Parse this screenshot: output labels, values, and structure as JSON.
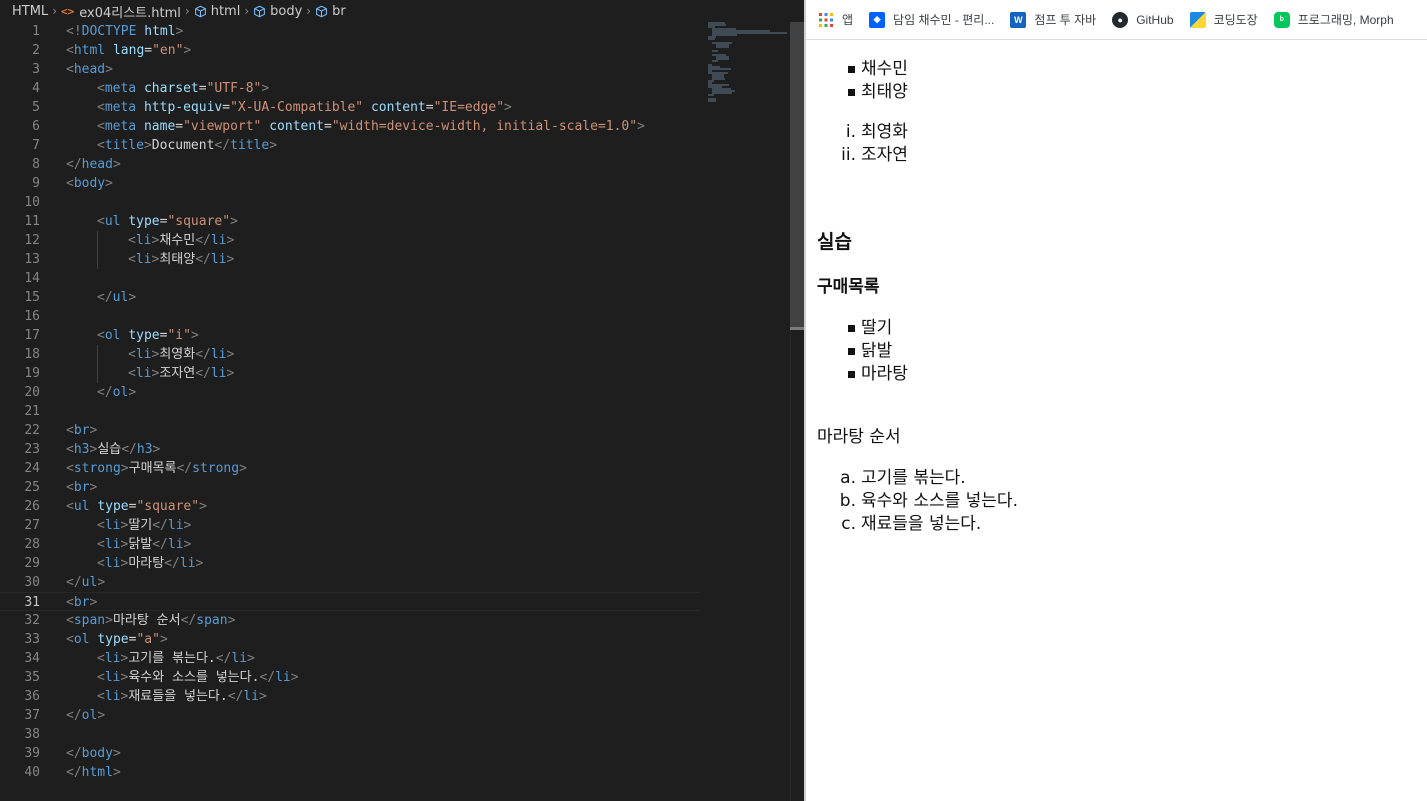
{
  "editor": {
    "breadcrumb": {
      "language": "HTML",
      "file": "ex04리스트.html",
      "path": [
        "html",
        "body",
        "br"
      ]
    },
    "active_line": 31,
    "lines": [
      {
        "n": "1",
        "indent": 0,
        "parts": [
          [
            "tg",
            "<!"
          ],
          [
            "tn",
            "DOCTYPE"
          ],
          [
            "tx",
            " "
          ],
          [
            "an",
            "html"
          ],
          [
            "tg",
            ">"
          ]
        ]
      },
      {
        "n": "2",
        "indent": 0,
        "parts": [
          [
            "tg",
            "<"
          ],
          [
            "tn",
            "html"
          ],
          [
            "tx",
            " "
          ],
          [
            "an",
            "lang"
          ],
          [
            "tx",
            "="
          ],
          [
            "av",
            "\"en\""
          ],
          [
            "tg",
            ">"
          ]
        ]
      },
      {
        "n": "3",
        "indent": 0,
        "parts": [
          [
            "tg",
            "<"
          ],
          [
            "tn",
            "head"
          ],
          [
            "tg",
            ">"
          ]
        ]
      },
      {
        "n": "4",
        "indent": 1,
        "parts": [
          [
            "tg",
            "<"
          ],
          [
            "tn",
            "meta"
          ],
          [
            "tx",
            " "
          ],
          [
            "an",
            "charset"
          ],
          [
            "tx",
            "="
          ],
          [
            "av",
            "\"UTF-8\""
          ],
          [
            "tg",
            ">"
          ]
        ]
      },
      {
        "n": "5",
        "indent": 1,
        "parts": [
          [
            "tg",
            "<"
          ],
          [
            "tn",
            "meta"
          ],
          [
            "tx",
            " "
          ],
          [
            "an",
            "http-equiv"
          ],
          [
            "tx",
            "="
          ],
          [
            "av",
            "\"X-UA-Compatible\""
          ],
          [
            "tx",
            " "
          ],
          [
            "an",
            "content"
          ],
          [
            "tx",
            "="
          ],
          [
            "av",
            "\"IE=edge\""
          ],
          [
            "tg",
            ">"
          ]
        ]
      },
      {
        "n": "6",
        "indent": 1,
        "parts": [
          [
            "tg",
            "<"
          ],
          [
            "tn",
            "meta"
          ],
          [
            "tx",
            " "
          ],
          [
            "an",
            "name"
          ],
          [
            "tx",
            "="
          ],
          [
            "av",
            "\"viewport\""
          ],
          [
            "tx",
            " "
          ],
          [
            "an",
            "content"
          ],
          [
            "tx",
            "="
          ],
          [
            "av",
            "\"width=device-width, initial-scale=1.0\""
          ],
          [
            "tg",
            ">"
          ]
        ]
      },
      {
        "n": "7",
        "indent": 1,
        "parts": [
          [
            "tg",
            "<"
          ],
          [
            "tn",
            "title"
          ],
          [
            "tg",
            ">"
          ],
          [
            "tx",
            "Document"
          ],
          [
            "tg",
            "</"
          ],
          [
            "tn",
            "title"
          ],
          [
            "tg",
            ">"
          ]
        ]
      },
      {
        "n": "8",
        "indent": 0,
        "parts": [
          [
            "tg",
            "</"
          ],
          [
            "tn",
            "head"
          ],
          [
            "tg",
            ">"
          ]
        ]
      },
      {
        "n": "9",
        "indent": 0,
        "parts": [
          [
            "tg",
            "<"
          ],
          [
            "tn",
            "body"
          ],
          [
            "tg",
            ">"
          ]
        ]
      },
      {
        "n": "10",
        "indent": 0,
        "parts": []
      },
      {
        "n": "11",
        "indent": 1,
        "parts": [
          [
            "tg",
            "<"
          ],
          [
            "tn",
            "ul"
          ],
          [
            "tx",
            " "
          ],
          [
            "an",
            "type"
          ],
          [
            "tx",
            "="
          ],
          [
            "av",
            "\"square\""
          ],
          [
            "tg",
            ">"
          ]
        ]
      },
      {
        "n": "12",
        "indent": 2,
        "parts": [
          [
            "tg",
            "<"
          ],
          [
            "tn",
            "li"
          ],
          [
            "tg",
            ">"
          ],
          [
            "tx",
            "채수민"
          ],
          [
            "tg",
            "</"
          ],
          [
            "tn",
            "li"
          ],
          [
            "tg",
            ">"
          ]
        ]
      },
      {
        "n": "13",
        "indent": 2,
        "parts": [
          [
            "tg",
            "<"
          ],
          [
            "tn",
            "li"
          ],
          [
            "tg",
            ">"
          ],
          [
            "tx",
            "최태양"
          ],
          [
            "tg",
            "</"
          ],
          [
            "tn",
            "li"
          ],
          [
            "tg",
            ">"
          ]
        ]
      },
      {
        "n": "14",
        "indent": 0,
        "parts": []
      },
      {
        "n": "15",
        "indent": 1,
        "parts": [
          [
            "tg",
            "</"
          ],
          [
            "tn",
            "ul"
          ],
          [
            "tg",
            ">"
          ]
        ]
      },
      {
        "n": "16",
        "indent": 0,
        "parts": []
      },
      {
        "n": "17",
        "indent": 1,
        "parts": [
          [
            "tg",
            "<"
          ],
          [
            "tn",
            "ol"
          ],
          [
            "tx",
            " "
          ],
          [
            "an",
            "type"
          ],
          [
            "tx",
            "="
          ],
          [
            "av",
            "\"i\""
          ],
          [
            "tg",
            ">"
          ]
        ]
      },
      {
        "n": "18",
        "indent": 2,
        "parts": [
          [
            "tg",
            "<"
          ],
          [
            "tn",
            "li"
          ],
          [
            "tg",
            ">"
          ],
          [
            "tx",
            "최영화"
          ],
          [
            "tg",
            "</"
          ],
          [
            "tn",
            "li"
          ],
          [
            "tg",
            ">"
          ]
        ]
      },
      {
        "n": "19",
        "indent": 2,
        "parts": [
          [
            "tg",
            "<"
          ],
          [
            "tn",
            "li"
          ],
          [
            "tg",
            ">"
          ],
          [
            "tx",
            "조자연"
          ],
          [
            "tg",
            "</"
          ],
          [
            "tn",
            "li"
          ],
          [
            "tg",
            ">"
          ]
        ]
      },
      {
        "n": "20",
        "indent": 1,
        "parts": [
          [
            "tg",
            "</"
          ],
          [
            "tn",
            "ol"
          ],
          [
            "tg",
            ">"
          ]
        ]
      },
      {
        "n": "21",
        "indent": 0,
        "parts": []
      },
      {
        "n": "22",
        "indent": 0,
        "parts": [
          [
            "tg",
            "<"
          ],
          [
            "tn",
            "br"
          ],
          [
            "tg",
            ">"
          ]
        ]
      },
      {
        "n": "23",
        "indent": 0,
        "parts": [
          [
            "tg",
            "<"
          ],
          [
            "tn",
            "h3"
          ],
          [
            "tg",
            ">"
          ],
          [
            "tx",
            "실습"
          ],
          [
            "tg",
            "</"
          ],
          [
            "tn",
            "h3"
          ],
          [
            "tg",
            ">"
          ]
        ]
      },
      {
        "n": "24",
        "indent": 0,
        "parts": [
          [
            "tg",
            "<"
          ],
          [
            "tn",
            "strong"
          ],
          [
            "tg",
            ">"
          ],
          [
            "tx",
            "구매목록"
          ],
          [
            "tg",
            "</"
          ],
          [
            "tn",
            "strong"
          ],
          [
            "tg",
            ">"
          ]
        ]
      },
      {
        "n": "25",
        "indent": 0,
        "parts": [
          [
            "tg",
            "<"
          ],
          [
            "tn",
            "br"
          ],
          [
            "tg",
            ">"
          ]
        ]
      },
      {
        "n": "26",
        "indent": 0,
        "parts": [
          [
            "tg",
            "<"
          ],
          [
            "tn",
            "ul"
          ],
          [
            "tx",
            " "
          ],
          [
            "an",
            "type"
          ],
          [
            "tx",
            "="
          ],
          [
            "av",
            "\"square\""
          ],
          [
            "tg",
            ">"
          ]
        ]
      },
      {
        "n": "27",
        "indent": 1,
        "parts": [
          [
            "tg",
            "<"
          ],
          [
            "tn",
            "li"
          ],
          [
            "tg",
            ">"
          ],
          [
            "tx",
            "딸기"
          ],
          [
            "tg",
            "</"
          ],
          [
            "tn",
            "li"
          ],
          [
            "tg",
            ">"
          ]
        ]
      },
      {
        "n": "28",
        "indent": 1,
        "parts": [
          [
            "tg",
            "<"
          ],
          [
            "tn",
            "li"
          ],
          [
            "tg",
            ">"
          ],
          [
            "tx",
            "닭발"
          ],
          [
            "tg",
            "</"
          ],
          [
            "tn",
            "li"
          ],
          [
            "tg",
            ">"
          ]
        ]
      },
      {
        "n": "29",
        "indent": 1,
        "parts": [
          [
            "tg",
            "<"
          ],
          [
            "tn",
            "li"
          ],
          [
            "tg",
            ">"
          ],
          [
            "tx",
            "마라탕"
          ],
          [
            "tg",
            "</"
          ],
          [
            "tn",
            "li"
          ],
          [
            "tg",
            ">"
          ]
        ]
      },
      {
        "n": "30",
        "indent": 0,
        "parts": [
          [
            "tg",
            "</"
          ],
          [
            "tn",
            "ul"
          ],
          [
            "tg",
            ">"
          ]
        ]
      },
      {
        "n": "31",
        "indent": 0,
        "parts": [
          [
            "tg",
            "<"
          ],
          [
            "tn",
            "br"
          ],
          [
            "tg",
            ">"
          ]
        ]
      },
      {
        "n": "32",
        "indent": 0,
        "parts": [
          [
            "tg",
            "<"
          ],
          [
            "tn",
            "span"
          ],
          [
            "tg",
            ">"
          ],
          [
            "tx",
            "마라탕 순서"
          ],
          [
            "tg",
            "</"
          ],
          [
            "tn",
            "span"
          ],
          [
            "tg",
            ">"
          ]
        ]
      },
      {
        "n": "33",
        "indent": 0,
        "parts": [
          [
            "tg",
            "<"
          ],
          [
            "tn",
            "ol"
          ],
          [
            "tx",
            " "
          ],
          [
            "an",
            "type"
          ],
          [
            "tx",
            "="
          ],
          [
            "av",
            "\"a\""
          ],
          [
            "tg",
            ">"
          ]
        ]
      },
      {
        "n": "34",
        "indent": 1,
        "parts": [
          [
            "tg",
            "<"
          ],
          [
            "tn",
            "li"
          ],
          [
            "tg",
            ">"
          ],
          [
            "tx",
            "고기를 볶는다."
          ],
          [
            "tg",
            "</"
          ],
          [
            "tn",
            "li"
          ],
          [
            "tg",
            ">"
          ]
        ]
      },
      {
        "n": "35",
        "indent": 1,
        "parts": [
          [
            "tg",
            "<"
          ],
          [
            "tn",
            "li"
          ],
          [
            "tg",
            ">"
          ],
          [
            "tx",
            "육수와 소스를 넣는다."
          ],
          [
            "tg",
            "</"
          ],
          [
            "tn",
            "li"
          ],
          [
            "tg",
            ">"
          ]
        ]
      },
      {
        "n": "36",
        "indent": 1,
        "parts": [
          [
            "tg",
            "<"
          ],
          [
            "tn",
            "li"
          ],
          [
            "tg",
            ">"
          ],
          [
            "tx",
            "재료들을 넣는다."
          ],
          [
            "tg",
            "</"
          ],
          [
            "tn",
            "li"
          ],
          [
            "tg",
            ">"
          ]
        ]
      },
      {
        "n": "37",
        "indent": 0,
        "parts": [
          [
            "tg",
            "</"
          ],
          [
            "tn",
            "ol"
          ],
          [
            "tg",
            ">"
          ]
        ]
      },
      {
        "n": "38",
        "indent": 0,
        "parts": []
      },
      {
        "n": "39",
        "indent": 0,
        "parts": [
          [
            "tg",
            "</"
          ],
          [
            "tn",
            "body"
          ],
          [
            "tg",
            ">"
          ]
        ]
      },
      {
        "n": "40",
        "indent": 0,
        "parts": [
          [
            "tg",
            "</"
          ],
          [
            "tn",
            "html"
          ],
          [
            "tg",
            ">"
          ]
        ]
      }
    ],
    "colors": {
      "background": "#1e1e1e",
      "tag": "#569cd6",
      "attr": "#9cdcfe",
      "value": "#ce9178",
      "bracket": "#808080"
    }
  },
  "browser": {
    "bookmarks": [
      {
        "label": "앱",
        "icon": "apps-grid-icon"
      },
      {
        "label": "담임 채수민 - 편리...",
        "icon": "dropbox-icon"
      },
      {
        "label": "점프 투 자바",
        "icon": "book-icon"
      },
      {
        "label": "GitHub",
        "icon": "github-icon"
      },
      {
        "label": "코딩도장",
        "icon": "coding-dojang-icon"
      },
      {
        "label": "프로그래밍, Morph",
        "icon": "blog-icon"
      }
    ],
    "page": {
      "list1": [
        "채수민",
        "최태양"
      ],
      "list2": {
        "markers": [
          "i.",
          "ii."
        ],
        "items": [
          "최영화",
          "조자연"
        ]
      },
      "heading": "실습",
      "strong": "구매목록",
      "list3": [
        "딸기",
        "닭발",
        "마라탕"
      ],
      "span": "마라탕 순서",
      "list4": {
        "markers": [
          "a.",
          "b.",
          "c."
        ],
        "items": [
          "고기를 볶는다.",
          "육수와 소스를 넣는다.",
          "재료들을 넣는다."
        ]
      }
    }
  }
}
